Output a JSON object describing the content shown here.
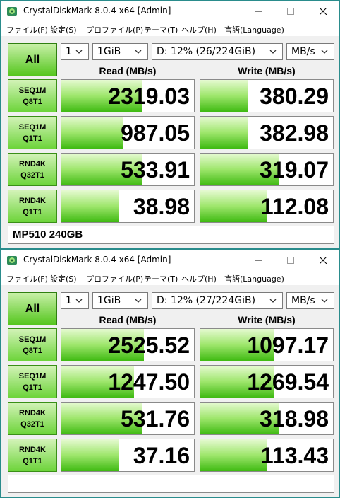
{
  "windows": [
    {
      "title": "CrystalDiskMark 8.0.4 x64 [Admin]",
      "menu": [
        "ファイル(F)",
        "設定(S)",
        "プロファイル(P)",
        "テーマ(T)",
        "ヘルプ(H)",
        "言語(Language)"
      ],
      "all_label": "All",
      "count": "1",
      "size": "1GiB",
      "drive": "D: 12% (26/224GiB)",
      "unit": "MB/s",
      "read_header": "Read (MB/s)",
      "write_header": "Write (MB/s)",
      "tests": [
        {
          "line1": "SEQ1M",
          "line2": "Q8T1",
          "read": "2319.03",
          "write": "380.29",
          "read_level": 0.61,
          "write_level": 0.36
        },
        {
          "line1": "SEQ1M",
          "line2": "Q1T1",
          "read": "987.05",
          "write": "382.98",
          "read_level": 0.47,
          "write_level": 0.36
        },
        {
          "line1": "RND4K",
          "line2": "Q32T1",
          "read": "533.91",
          "write": "319.07",
          "read_level": 0.61,
          "write_level": 0.59
        },
        {
          "line1": "RND4K",
          "line2": "Q1T1",
          "read": "38.98",
          "write": "112.08",
          "read_level": 0.43,
          "write_level": 0.5
        }
      ],
      "comment": "MP510 240GB"
    },
    {
      "title": "CrystalDiskMark 8.0.4 x64 [Admin]",
      "menu": [
        "ファイル(F)",
        "設定(S)",
        "プロファイル(P)",
        "テーマ(T)",
        "ヘルプ(H)",
        "言語(Language)"
      ],
      "all_label": "All",
      "count": "1",
      "size": "1GiB",
      "drive": "D: 12% (27/224GiB)",
      "unit": "MB/s",
      "read_header": "Read (MB/s)",
      "write_header": "Write (MB/s)",
      "tests": [
        {
          "line1": "SEQ1M",
          "line2": "Q8T1",
          "read": "2525.52",
          "write": "1097.17",
          "read_level": 0.62,
          "write_level": 0.56
        },
        {
          "line1": "SEQ1M",
          "line2": "Q1T1",
          "read": "1247.50",
          "write": "1269.54",
          "read_level": 0.55,
          "write_level": 0.56
        },
        {
          "line1": "RND4K",
          "line2": "Q32T1",
          "read": "531.76",
          "write": "318.98",
          "read_level": 0.61,
          "write_level": 0.59
        },
        {
          "line1": "RND4K",
          "line2": "Q1T1",
          "read": "37.16",
          "write": "113.43",
          "read_level": 0.43,
          "write_level": 0.5
        }
      ],
      "comment": ""
    }
  ]
}
